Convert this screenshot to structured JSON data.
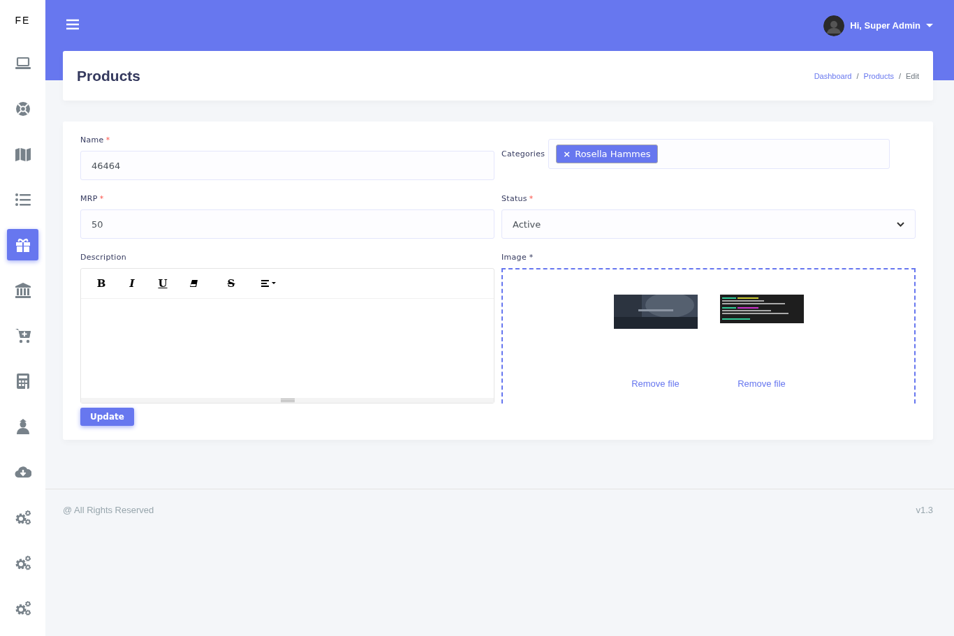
{
  "sidebar": {
    "logo": "FE",
    "items": [
      {
        "selected": false
      },
      {
        "selected": false
      },
      {
        "selected": false
      },
      {
        "selected": false
      },
      {
        "selected": true
      },
      {
        "selected": false
      },
      {
        "selected": false
      },
      {
        "selected": false
      },
      {
        "selected": false
      },
      {
        "selected": false
      },
      {
        "selected": false
      },
      {
        "selected": false
      },
      {
        "selected": false
      }
    ]
  },
  "topbar": {
    "user": "Hi, Super Admin"
  },
  "page": {
    "title": "Products",
    "breadcrumb": [
      {
        "label": "Dashboard",
        "link": true
      },
      {
        "label": "Products",
        "link": true
      },
      {
        "label": "Edit",
        "link": false
      }
    ],
    "separator": "/"
  },
  "form": {
    "name": {
      "label": "Name",
      "required": "*",
      "value": "46464"
    },
    "categories": {
      "label": "Categories",
      "tags": [
        {
          "remove": "×",
          "label": "Rosella Hammes"
        }
      ]
    },
    "mrp": {
      "label": "MRP",
      "required": "*",
      "value": "50"
    },
    "status": {
      "label": "Status",
      "required": "*",
      "value": "Active"
    },
    "description": {
      "label": "Description",
      "toolbar": [
        {
          "kind": "bold",
          "label": "B"
        },
        {
          "kind": "italic",
          "label": "I"
        },
        {
          "kind": "underline",
          "label": "U"
        },
        {
          "kind": "eraser"
        },
        {
          "kind": "strike",
          "label": "S"
        },
        {
          "kind": "align"
        }
      ]
    },
    "image": {
      "label": "Image *",
      "files": [
        {
          "kind": "picture",
          "remove": "Remove file"
        },
        {
          "kind": "picture",
          "remove": "Remove file"
        }
      ]
    },
    "submit": "Update"
  },
  "footer": {
    "copyright": "@ All Rights Reserved",
    "version": "v1.3"
  }
}
